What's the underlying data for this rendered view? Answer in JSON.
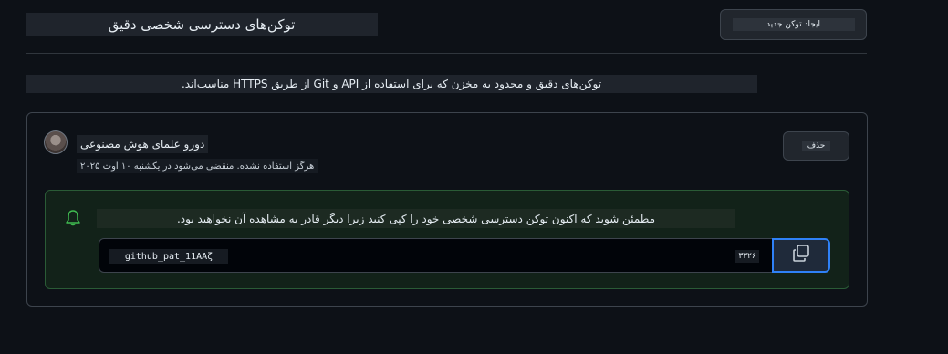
{
  "header": {
    "title": "توکن‌های دسترسی شخصی دقیق",
    "generate_button_label": "ایجاد توکن جدید"
  },
  "description": "توکن‌های دقیق و محدود به مخزن که برای استفاده از API و Git از طریق HTTPS مناسب‌اند.",
  "token": {
    "name": "دورو علمای هوش مصنوعی",
    "meta": "هرگز استفاده نشده. منقضی می‌شود در یکشنبه ۱۰ اوت ۲۰۲۵",
    "delete_button_label": "حذف",
    "notice": "مطمئن شوید که اکنون توکن دسترسی شخصی خود را کپی کنید زیرا دیگر قادر به مشاهده آن نخواهید بود.",
    "value": "github_pat_11ΑΑζ",
    "tail": "۳۳۲۶"
  },
  "icons": {
    "bell": "bell-icon",
    "copy": "copy-icon",
    "avatar": "avatar"
  },
  "colors": {
    "success_border": "#2a5b36",
    "accent": "#2f81f7",
    "icon_green": "#3fb950"
  }
}
